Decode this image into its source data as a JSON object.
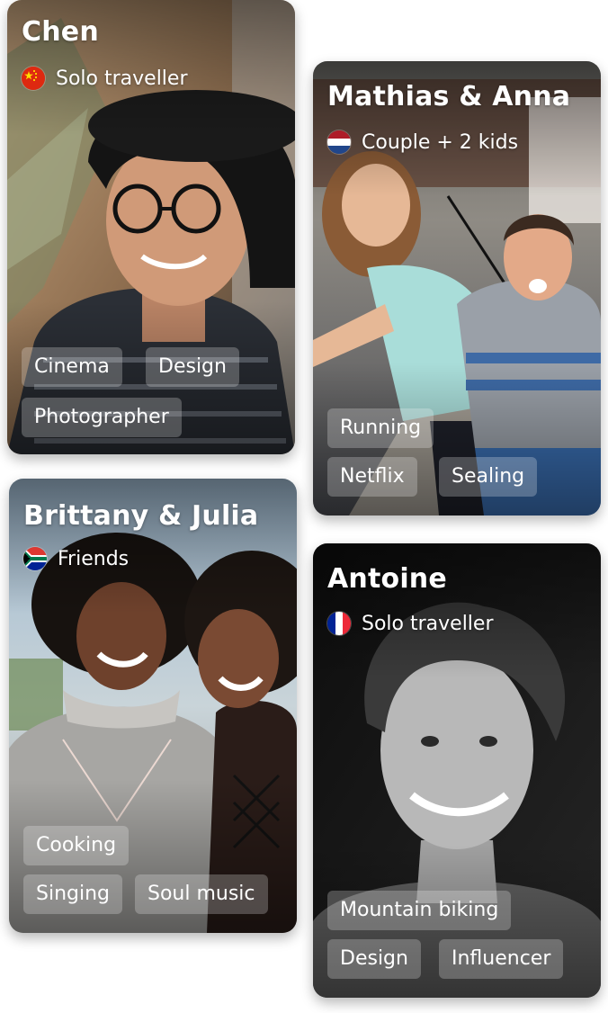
{
  "cards": [
    {
      "name": "Chen",
      "type": "Solo traveller",
      "flag": "china-flag",
      "tags": [
        "Cinema",
        "Design",
        "Photographer"
      ]
    },
    {
      "name": "Mathias & Anna",
      "type": "Couple + 2 kids",
      "flag": "netherlands-flag",
      "tags": [
        "Running",
        "Netflix",
        "Sealing"
      ]
    },
    {
      "name": "Brittany & Julia",
      "type": "Friends",
      "flag": "south-africa-flag",
      "tags": [
        "Cooking",
        "Singing",
        "Soul music"
      ]
    },
    {
      "name": "Antoine",
      "type": "Solo traveller",
      "flag": "france-flag",
      "tags": [
        "Mountain biking",
        "Design",
        "Influencer"
      ]
    }
  ]
}
